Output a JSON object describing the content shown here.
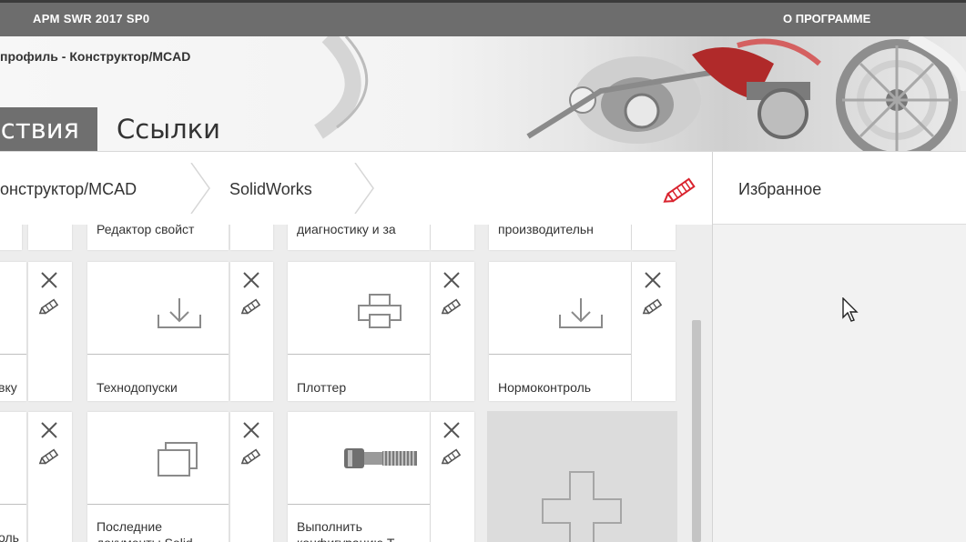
{
  "topbar": {
    "app_title": "APM SWR 2017 SP0",
    "about": "О ПРОГРАММЕ"
  },
  "banner": {
    "profile_text": "профиль - Конструктор/MCAD"
  },
  "tabs": [
    {
      "label": "ствия"
    },
    {
      "label": "Ссылки"
    }
  ],
  "breadcrumb": [
    {
      "label": "онструктор/MCAD"
    },
    {
      "label": "SolidWorks"
    }
  ],
  "favorites": {
    "title": "Избранное"
  },
  "tiles_row0": [
    {
      "label": ""
    },
    {
      "label": "Редактор свойст"
    },
    {
      "label": "диагностику и за"
    },
    {
      "label": "производительн"
    }
  ],
  "tiles_row1": [
    {
      "label": "вку",
      "icon": "download-icon"
    },
    {
      "label": "Технодопуски",
      "icon": "download-icon"
    },
    {
      "label": "Плоттер",
      "icon": "printer-icon"
    },
    {
      "label": "Нормоконтроль",
      "icon": "download-icon"
    }
  ],
  "tiles_row2": [
    {
      "label": "оль",
      "icon": "unknown-icon"
    },
    {
      "label_line1": "Последние",
      "label_line2": "документы Solid",
      "icon": "windows-stack-icon"
    },
    {
      "label_line1": "Выполнить",
      "label_line2": "конфигурацию Т",
      "icon": "bolt-icon"
    }
  ],
  "add_tile": {
    "icon": "plus-icon"
  },
  "colors": {
    "topbar": "#6d6d6d",
    "active_tab": "#6f6f6f",
    "edit_accent": "#d9232e",
    "grid_bg": "#ededed",
    "favorites_bg": "#f2f2f2"
  }
}
